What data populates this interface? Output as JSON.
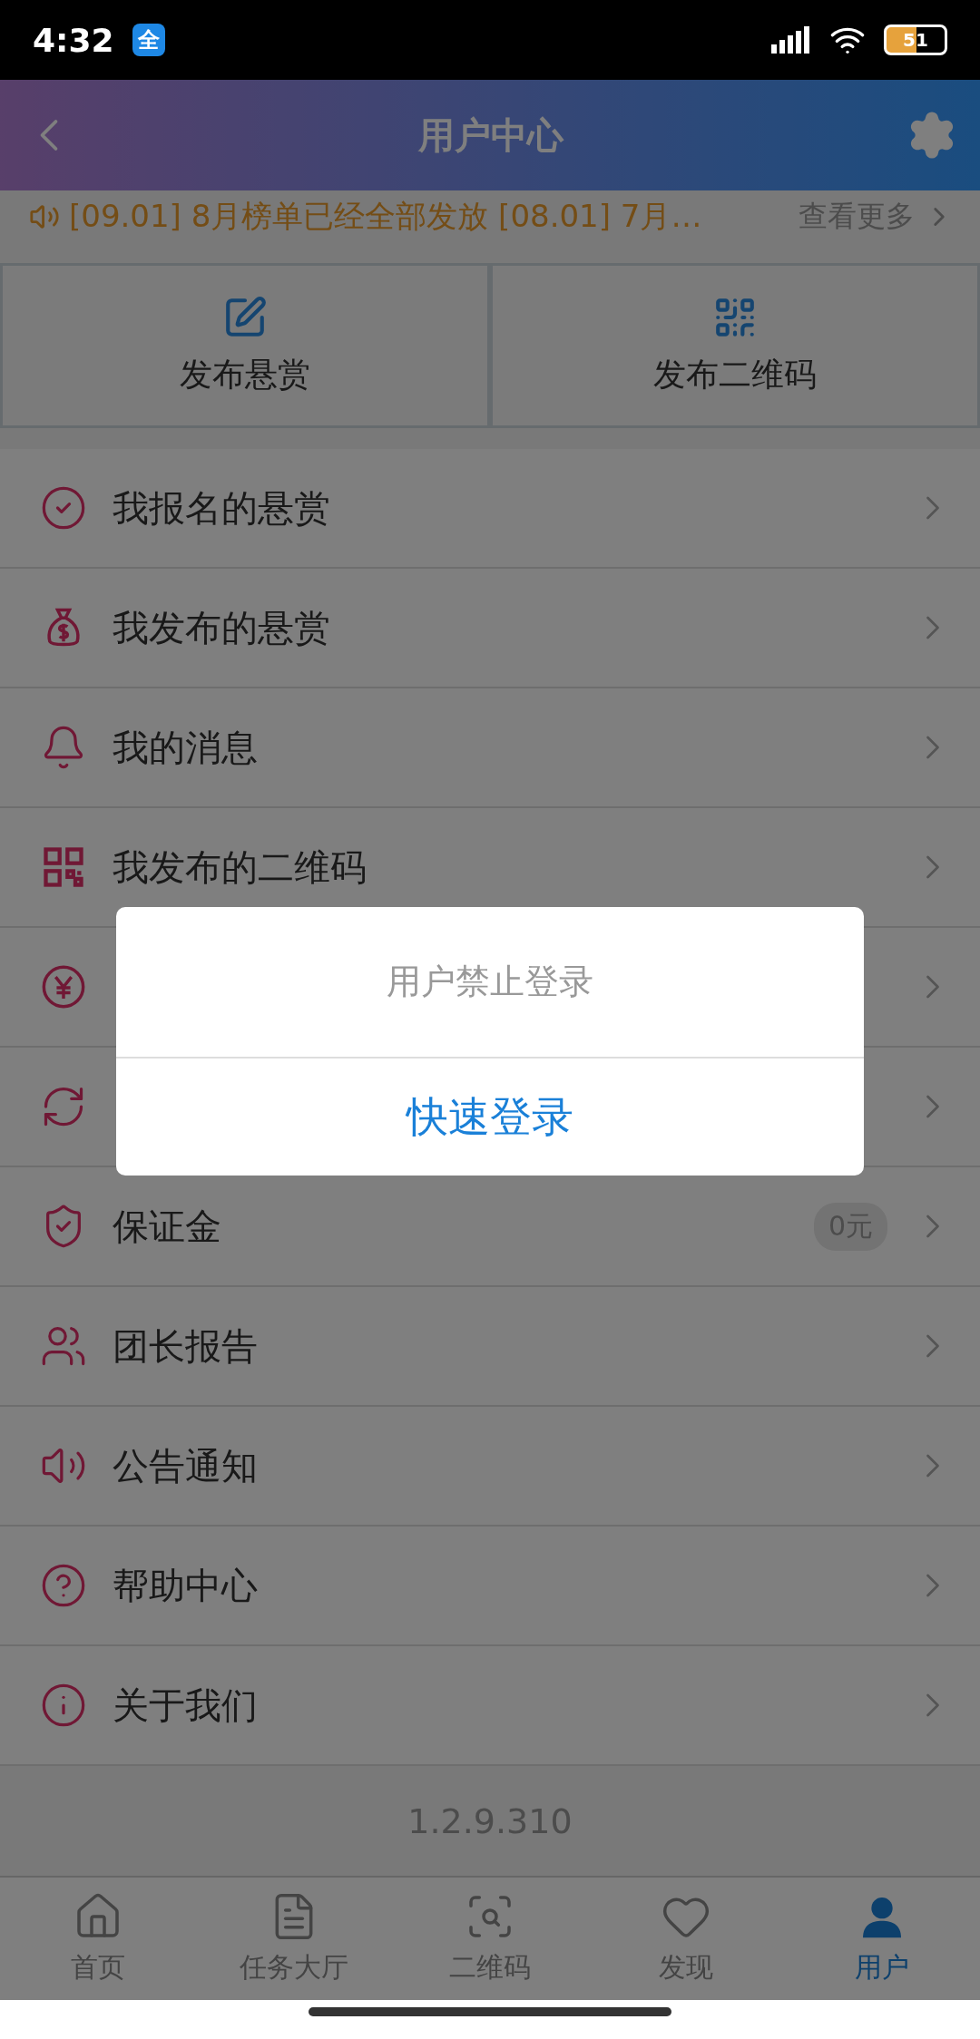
{
  "status_bar": {
    "time": "4:32",
    "app_badge": "全",
    "battery": "51"
  },
  "header": {
    "title": "用户中心"
  },
  "notice": {
    "text": "[09.01] 8月榜单已经全部发放 [08.01] 7月…",
    "more": "查看更多"
  },
  "shortcuts": [
    {
      "label": "发布悬赏"
    },
    {
      "label": "发布二维码"
    }
  ],
  "menu": [
    {
      "kind": "item",
      "label": "我报名的悬赏"
    },
    {
      "kind": "item",
      "label": "我发布的悬赏"
    },
    {
      "kind": "item",
      "label": "我的消息"
    },
    {
      "kind": "item",
      "label": "我发布的二维码"
    },
    {
      "kind": "covered"
    },
    {
      "kind": "covered"
    },
    {
      "kind": "item",
      "label": "保证金",
      "badge": "0元"
    },
    {
      "kind": "item",
      "label": "团长报告"
    },
    {
      "kind": "item",
      "label": "公告通知"
    },
    {
      "kind": "item",
      "label": "帮助中心"
    },
    {
      "kind": "item",
      "label": "关于我们"
    }
  ],
  "version": "1.2.9.310",
  "tabs": [
    {
      "label": "首页",
      "selected": false
    },
    {
      "label": "任务大厅",
      "selected": false
    },
    {
      "label": "二维码",
      "selected": false
    },
    {
      "label": "发现",
      "selected": false
    },
    {
      "label": "用户",
      "selected": true
    }
  ],
  "dialog": {
    "message": "用户禁止登录",
    "button": "快速登录"
  }
}
